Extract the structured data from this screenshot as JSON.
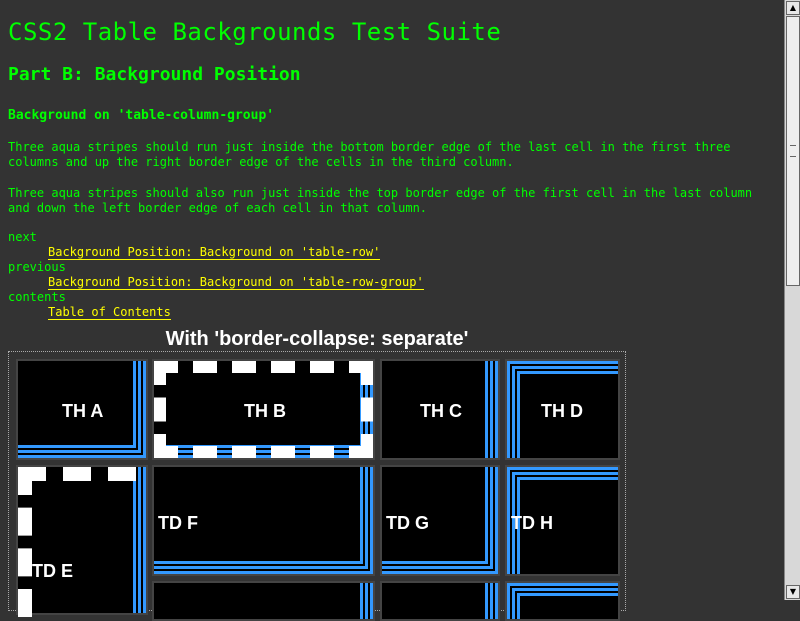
{
  "page": {
    "title": "CSS2 Table Backgrounds Test Suite",
    "part": "Part B: Background Position",
    "subtitle": "Background on 'table-column-group'",
    "desc1": "Three aqua stripes should run just inside the bottom border edge of the last cell in the first three columns and up the right border edge of the cells in the third column.",
    "desc2": "Three aqua stripes should also run just inside the top border edge of the first cell in the last column and down the left border edge of each cell in that column."
  },
  "nav": {
    "next_label": "next",
    "next_link": "Background Position: Background on 'table-row'",
    "previous_label": "previous",
    "previous_link": "Background Position: Background on 'table-row-group'",
    "contents_label": "contents",
    "contents_link": "Table of Contents"
  },
  "table": {
    "caption": "With 'border-collapse: separate'",
    "cells": {
      "tha": "TH A",
      "thb": "TH B",
      "thc": "TH C",
      "thd": "TH D",
      "tde": "TD E",
      "tdf": "TD F",
      "tdg": "TD G",
      "tdh": "TD H"
    }
  },
  "colors": {
    "background": "#333333",
    "text": "#00ff00",
    "link": "#ffff00",
    "stripe": "#3399ff",
    "cell": "#000000"
  },
  "scrollbar": {
    "up_icon": "arrow-up-icon",
    "down_icon": "arrow-down-icon"
  }
}
